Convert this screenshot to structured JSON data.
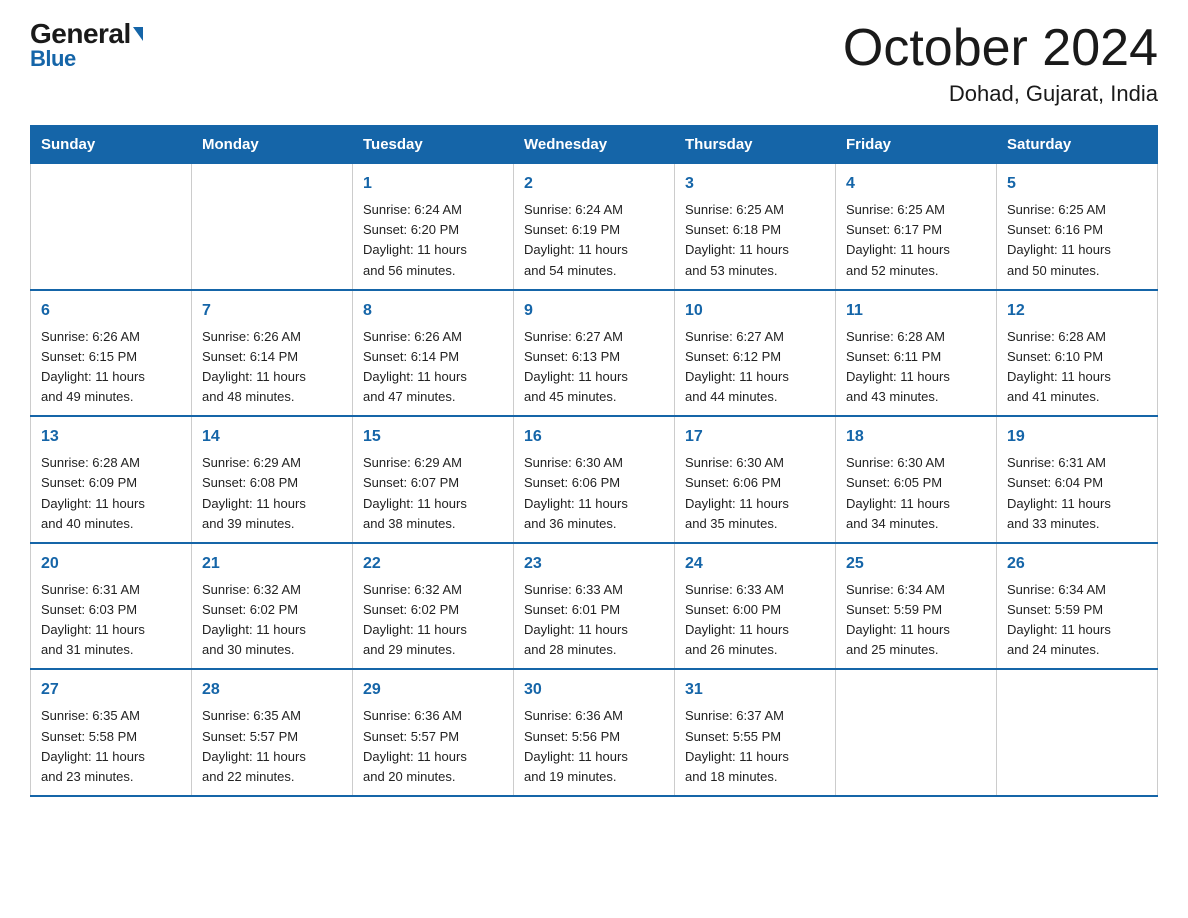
{
  "header": {
    "logo_general": "General",
    "logo_blue": "Blue",
    "title": "October 2024",
    "subtitle": "Dohad, Gujarat, India"
  },
  "days_of_week": [
    "Sunday",
    "Monday",
    "Tuesday",
    "Wednesday",
    "Thursday",
    "Friday",
    "Saturday"
  ],
  "weeks": [
    [
      {
        "day": "",
        "info": ""
      },
      {
        "day": "",
        "info": ""
      },
      {
        "day": "1",
        "info": "Sunrise: 6:24 AM\nSunset: 6:20 PM\nDaylight: 11 hours\nand 56 minutes."
      },
      {
        "day": "2",
        "info": "Sunrise: 6:24 AM\nSunset: 6:19 PM\nDaylight: 11 hours\nand 54 minutes."
      },
      {
        "day": "3",
        "info": "Sunrise: 6:25 AM\nSunset: 6:18 PM\nDaylight: 11 hours\nand 53 minutes."
      },
      {
        "day": "4",
        "info": "Sunrise: 6:25 AM\nSunset: 6:17 PM\nDaylight: 11 hours\nand 52 minutes."
      },
      {
        "day": "5",
        "info": "Sunrise: 6:25 AM\nSunset: 6:16 PM\nDaylight: 11 hours\nand 50 minutes."
      }
    ],
    [
      {
        "day": "6",
        "info": "Sunrise: 6:26 AM\nSunset: 6:15 PM\nDaylight: 11 hours\nand 49 minutes."
      },
      {
        "day": "7",
        "info": "Sunrise: 6:26 AM\nSunset: 6:14 PM\nDaylight: 11 hours\nand 48 minutes."
      },
      {
        "day": "8",
        "info": "Sunrise: 6:26 AM\nSunset: 6:14 PM\nDaylight: 11 hours\nand 47 minutes."
      },
      {
        "day": "9",
        "info": "Sunrise: 6:27 AM\nSunset: 6:13 PM\nDaylight: 11 hours\nand 45 minutes."
      },
      {
        "day": "10",
        "info": "Sunrise: 6:27 AM\nSunset: 6:12 PM\nDaylight: 11 hours\nand 44 minutes."
      },
      {
        "day": "11",
        "info": "Sunrise: 6:28 AM\nSunset: 6:11 PM\nDaylight: 11 hours\nand 43 minutes."
      },
      {
        "day": "12",
        "info": "Sunrise: 6:28 AM\nSunset: 6:10 PM\nDaylight: 11 hours\nand 41 minutes."
      }
    ],
    [
      {
        "day": "13",
        "info": "Sunrise: 6:28 AM\nSunset: 6:09 PM\nDaylight: 11 hours\nand 40 minutes."
      },
      {
        "day": "14",
        "info": "Sunrise: 6:29 AM\nSunset: 6:08 PM\nDaylight: 11 hours\nand 39 minutes."
      },
      {
        "day": "15",
        "info": "Sunrise: 6:29 AM\nSunset: 6:07 PM\nDaylight: 11 hours\nand 38 minutes."
      },
      {
        "day": "16",
        "info": "Sunrise: 6:30 AM\nSunset: 6:06 PM\nDaylight: 11 hours\nand 36 minutes."
      },
      {
        "day": "17",
        "info": "Sunrise: 6:30 AM\nSunset: 6:06 PM\nDaylight: 11 hours\nand 35 minutes."
      },
      {
        "day": "18",
        "info": "Sunrise: 6:30 AM\nSunset: 6:05 PM\nDaylight: 11 hours\nand 34 minutes."
      },
      {
        "day": "19",
        "info": "Sunrise: 6:31 AM\nSunset: 6:04 PM\nDaylight: 11 hours\nand 33 minutes."
      }
    ],
    [
      {
        "day": "20",
        "info": "Sunrise: 6:31 AM\nSunset: 6:03 PM\nDaylight: 11 hours\nand 31 minutes."
      },
      {
        "day": "21",
        "info": "Sunrise: 6:32 AM\nSunset: 6:02 PM\nDaylight: 11 hours\nand 30 minutes."
      },
      {
        "day": "22",
        "info": "Sunrise: 6:32 AM\nSunset: 6:02 PM\nDaylight: 11 hours\nand 29 minutes."
      },
      {
        "day": "23",
        "info": "Sunrise: 6:33 AM\nSunset: 6:01 PM\nDaylight: 11 hours\nand 28 minutes."
      },
      {
        "day": "24",
        "info": "Sunrise: 6:33 AM\nSunset: 6:00 PM\nDaylight: 11 hours\nand 26 minutes."
      },
      {
        "day": "25",
        "info": "Sunrise: 6:34 AM\nSunset: 5:59 PM\nDaylight: 11 hours\nand 25 minutes."
      },
      {
        "day": "26",
        "info": "Sunrise: 6:34 AM\nSunset: 5:59 PM\nDaylight: 11 hours\nand 24 minutes."
      }
    ],
    [
      {
        "day": "27",
        "info": "Sunrise: 6:35 AM\nSunset: 5:58 PM\nDaylight: 11 hours\nand 23 minutes."
      },
      {
        "day": "28",
        "info": "Sunrise: 6:35 AM\nSunset: 5:57 PM\nDaylight: 11 hours\nand 22 minutes."
      },
      {
        "day": "29",
        "info": "Sunrise: 6:36 AM\nSunset: 5:57 PM\nDaylight: 11 hours\nand 20 minutes."
      },
      {
        "day": "30",
        "info": "Sunrise: 6:36 AM\nSunset: 5:56 PM\nDaylight: 11 hours\nand 19 minutes."
      },
      {
        "day": "31",
        "info": "Sunrise: 6:37 AM\nSunset: 5:55 PM\nDaylight: 11 hours\nand 18 minutes."
      },
      {
        "day": "",
        "info": ""
      },
      {
        "day": "",
        "info": ""
      }
    ]
  ]
}
